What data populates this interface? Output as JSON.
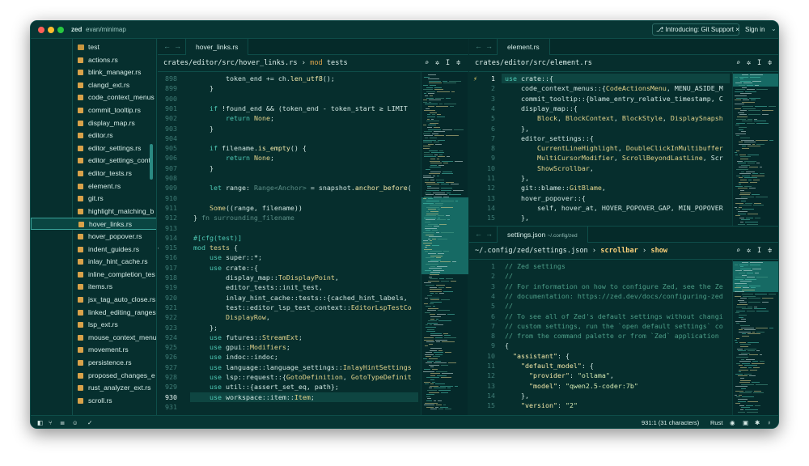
{
  "titlebar": {
    "project": "zed",
    "branch": "evan/minimap",
    "intro_label": "Introducing: Git Support",
    "sign_in": "Sign in"
  },
  "sidebar": {
    "items": [
      {
        "label": "test",
        "icon": "folder-icon"
      },
      {
        "label": "actions.rs"
      },
      {
        "label": "blink_manager.rs"
      },
      {
        "label": "clangd_ext.rs"
      },
      {
        "label": "code_context_menus"
      },
      {
        "label": "commit_tooltip.rs"
      },
      {
        "label": "display_map.rs"
      },
      {
        "label": "editor.rs"
      },
      {
        "label": "editor_settings.rs"
      },
      {
        "label": "editor_settings_contr"
      },
      {
        "label": "editor_tests.rs"
      },
      {
        "label": "element.rs"
      },
      {
        "label": "git.rs"
      },
      {
        "label": "highlight_matching_b"
      },
      {
        "label": "hover_links.rs",
        "selected": true
      },
      {
        "label": "hover_popover.rs"
      },
      {
        "label": "indent_guides.rs"
      },
      {
        "label": "inlay_hint_cache.rs"
      },
      {
        "label": "inline_completion_tes"
      },
      {
        "label": "items.rs"
      },
      {
        "label": "jsx_tag_auto_close.rs"
      },
      {
        "label": "linked_editing_ranges"
      },
      {
        "label": "lsp_ext.rs"
      },
      {
        "label": "mouse_context_menu"
      },
      {
        "label": "movement.rs"
      },
      {
        "label": "persistence.rs"
      },
      {
        "label": "proposed_changes_e"
      },
      {
        "label": "rust_analyzer_ext.rs"
      },
      {
        "label": "scroll.rs"
      }
    ]
  },
  "left_pane": {
    "tab": "hover_links.rs",
    "path": "crates/editor/src/hover_links.rs",
    "sep": "›",
    "sym_kw": "mod",
    "sym_name": "tests"
  },
  "right_top": {
    "tab": "element.rs",
    "path": "crates/editor/src/element.rs"
  },
  "right_bottom": {
    "tab": "settings.json",
    "tab_hint": "~/.config/zed",
    "path": "~/.config/zed/settings.json",
    "sep": "›",
    "crumb1": "scrollbar",
    "crumb2": "show"
  },
  "status": {
    "cursor": "931:1 (31 characters)",
    "language": "Rust"
  },
  "colors": {
    "accent": "#3aa39a",
    "bg": "#062e2d",
    "traffic": [
      "#ff5f57",
      "#febc2e",
      "#28c840"
    ]
  }
}
